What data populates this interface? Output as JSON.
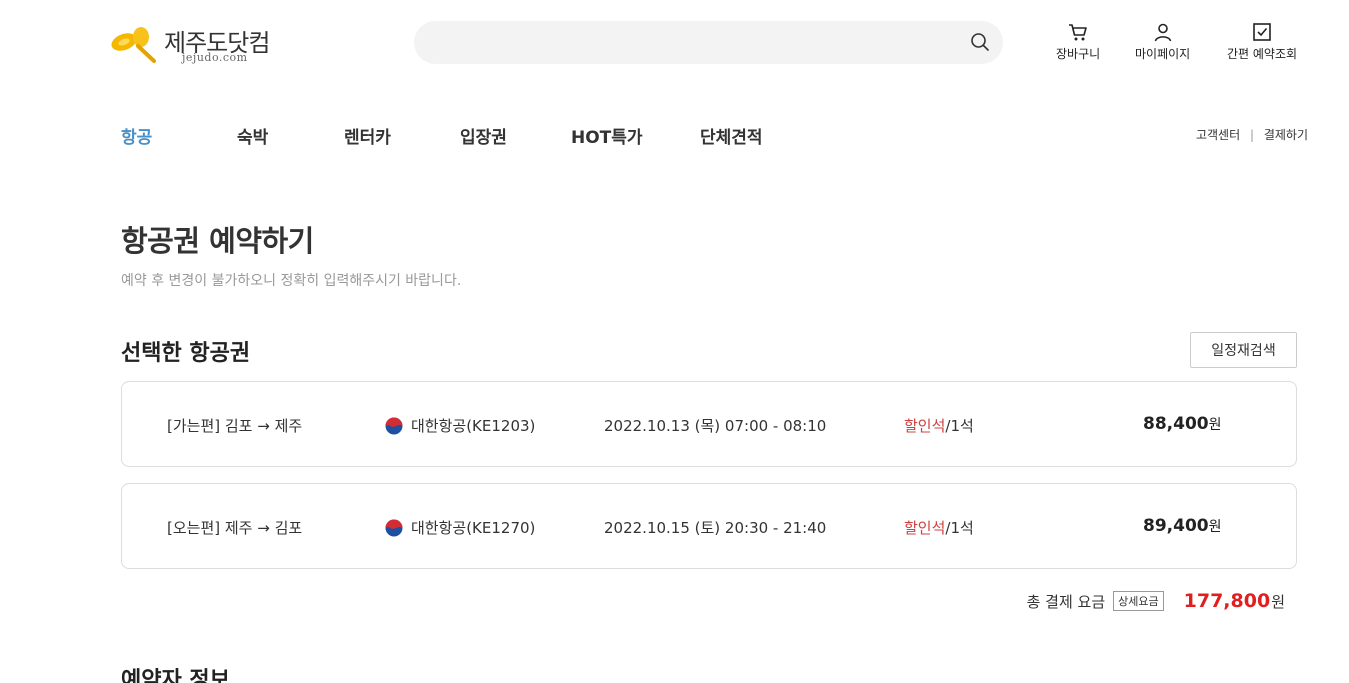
{
  "header": {
    "logo_name": "제주도닷컴",
    "logo_domain": "jejudo.com",
    "search_placeholder": "",
    "utils": [
      {
        "label": "장바구니",
        "icon": "cart-icon"
      },
      {
        "label": "마이페이지",
        "icon": "person-icon"
      },
      {
        "label": "간편 예약조회",
        "icon": "checkbox-icon"
      }
    ]
  },
  "nav": {
    "items": [
      "항공",
      "숙박",
      "렌터카",
      "입장권",
      "HOT특가",
      "단체견적"
    ],
    "active": "항공",
    "top_links": [
      "고객센터",
      "결제하기"
    ]
  },
  "page": {
    "title": "항공권 예약하기",
    "subtitle": "예약 후 변경이 불가하오니 정확히 입력해주시기 바랍니다."
  },
  "selected": {
    "title": "선택한 항공권",
    "research_label": "일정재검색",
    "flights": [
      {
        "direction": "[가는편] 김포 → 제주",
        "airline": "대한항공(KE1203)",
        "schedule": "2022.10.13 (목) 07:00 - 08:10",
        "seat_class": "할인석",
        "seat_count": "/1석",
        "price": "88,400",
        "won": "원"
      },
      {
        "direction": "[오는편] 제주 → 김포",
        "airline": "대한항공(KE1270)",
        "schedule": "2022.10.15 (토) 20:30 - 21:40",
        "seat_class": "할인석",
        "seat_count": "/1석",
        "price": "89,400",
        "won": "원"
      }
    ],
    "total_label": "총 결제 요금",
    "detail_label": "상세요금",
    "total_price": "177,800",
    "total_won": "원"
  },
  "booker": {
    "title": "예약자 정보"
  },
  "colors": {
    "accent": "#4a90c8",
    "price_red": "#e02020",
    "seat_red": "#d04040"
  }
}
